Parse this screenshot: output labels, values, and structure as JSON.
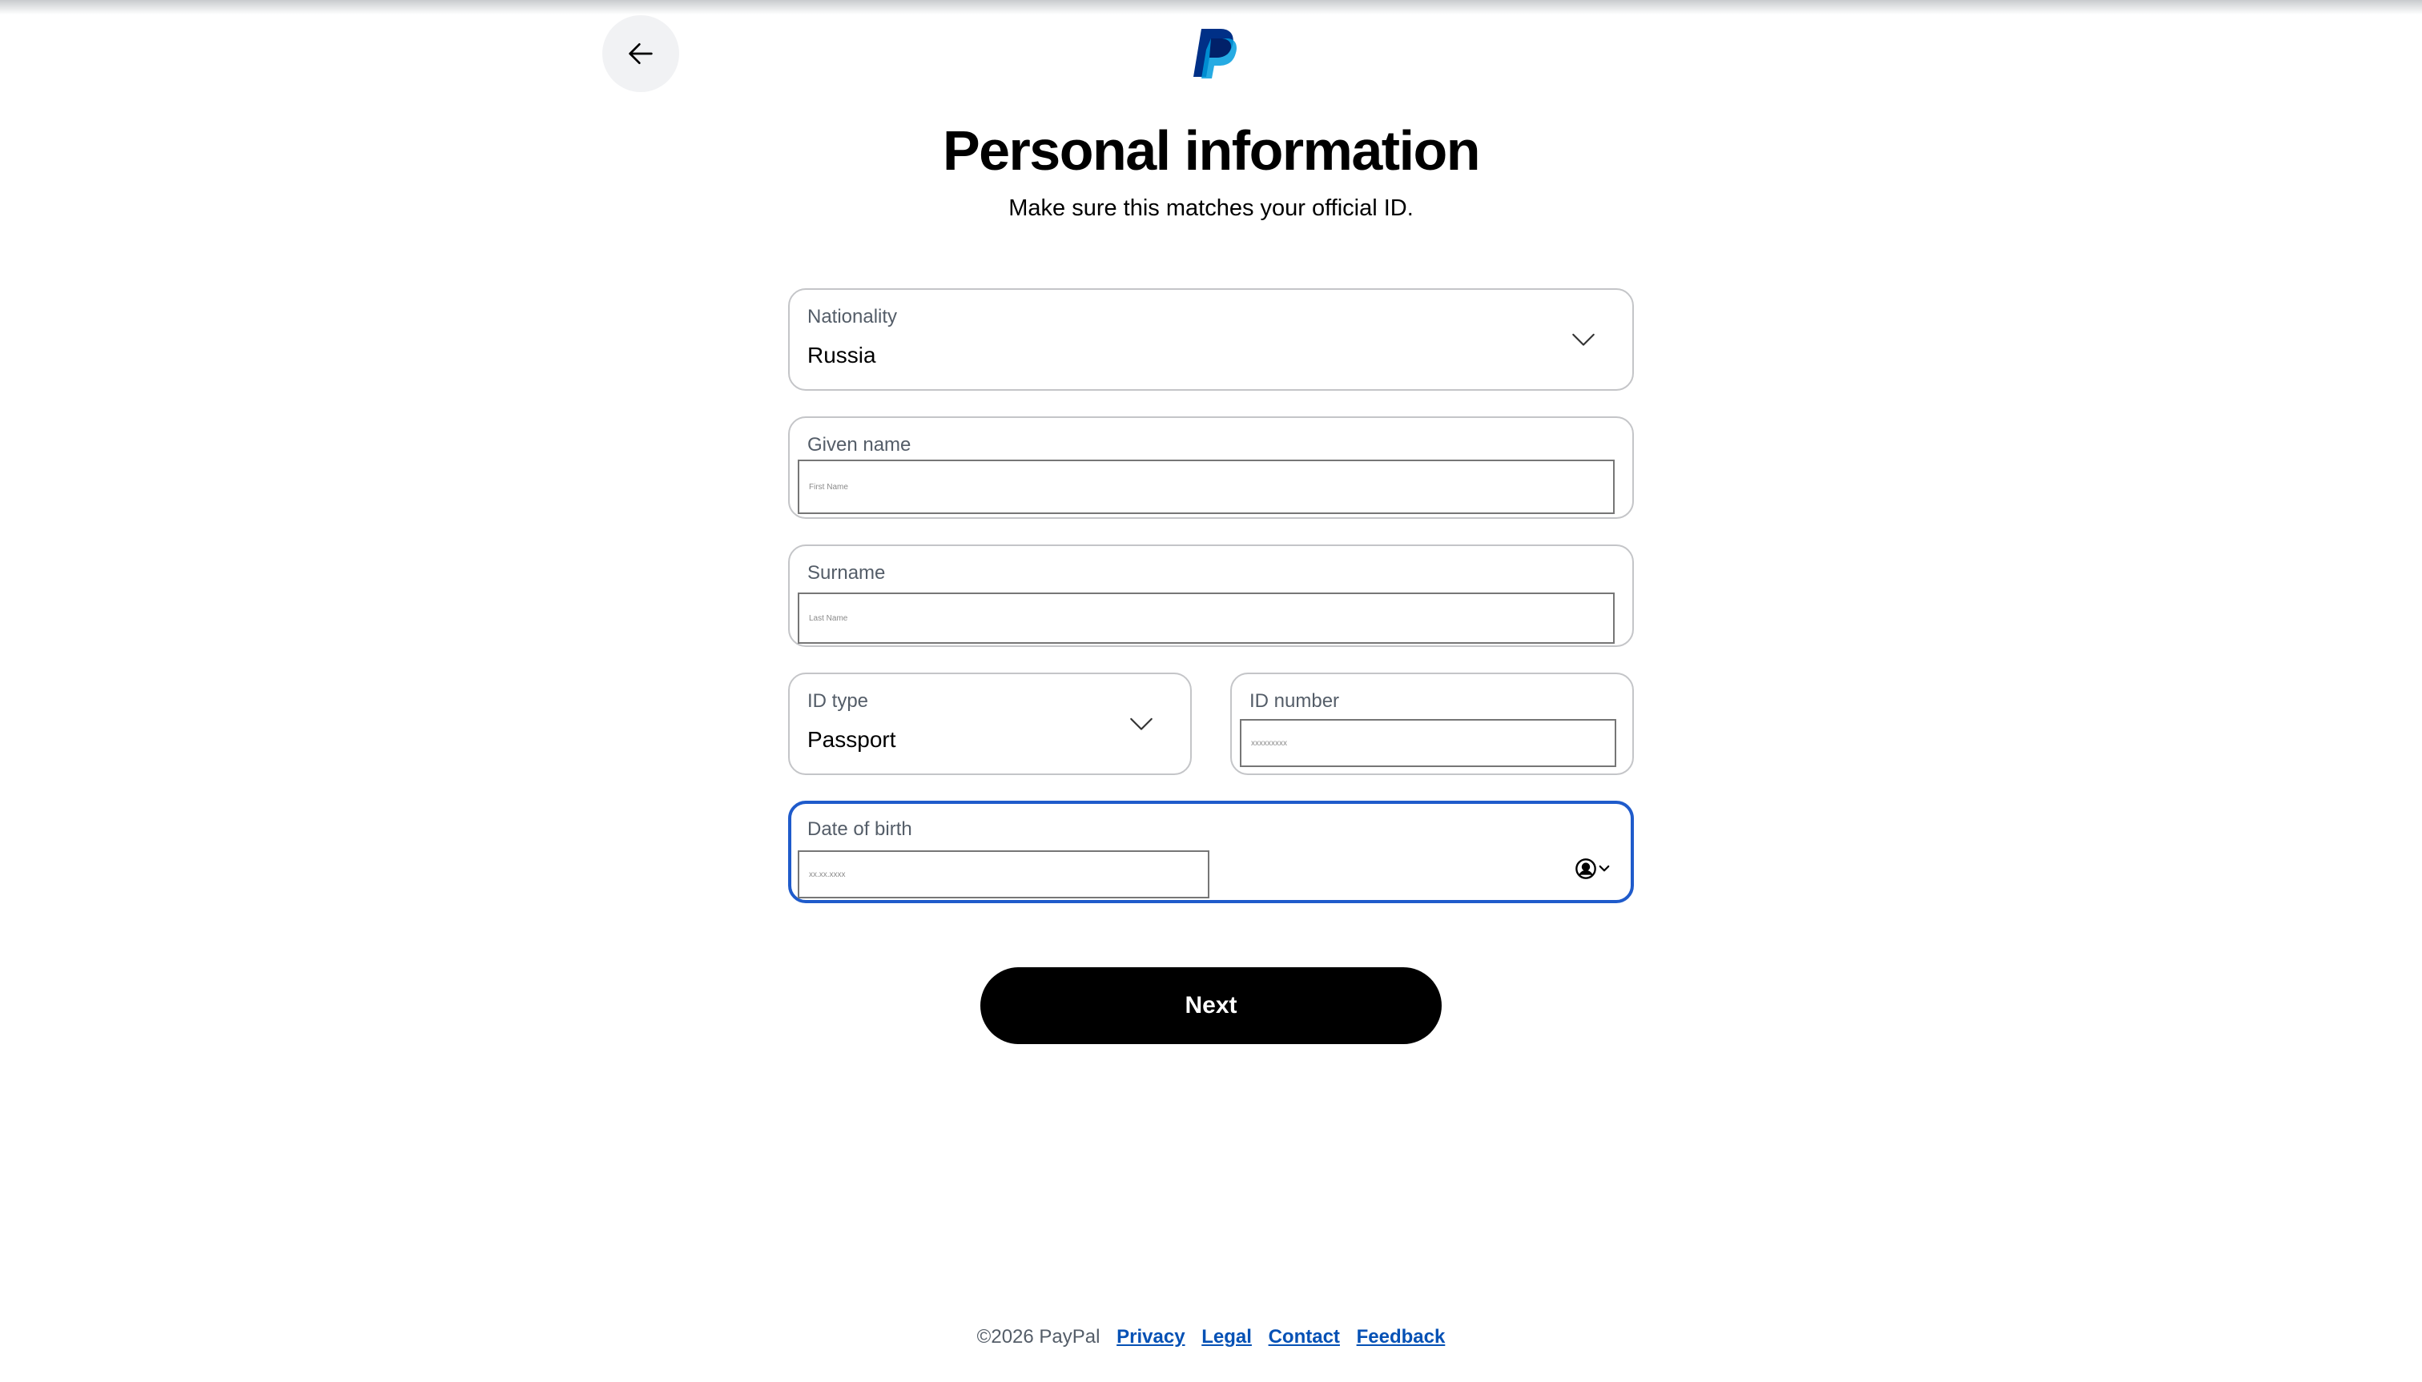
{
  "brand": {
    "name": "PayPal"
  },
  "header": {
    "back_icon": "arrow-left-icon",
    "logo_icon": "paypal-logo"
  },
  "main": {
    "title": "Personal information",
    "subtitle": "Make sure this matches your official ID."
  },
  "form": {
    "nationality": {
      "label": "Nationality",
      "value": "Russia"
    },
    "given_name": {
      "label": "Given name",
      "placeholder": "First Name",
      "value": ""
    },
    "surname": {
      "label": "Surname",
      "placeholder": "Last Name",
      "value": ""
    },
    "id_type": {
      "label": "ID type",
      "value": "Passport"
    },
    "id_number": {
      "label": "ID number",
      "placeholder": "xxxxxxxxx",
      "value": ""
    },
    "date_of_birth": {
      "label": "Date of birth",
      "placeholder": "xx.xx.xxxx",
      "value": "",
      "autofill_icon": "contact-autofill-icon"
    }
  },
  "actions": {
    "next_label": "Next"
  },
  "footer": {
    "copyright": "©2026 PayPal",
    "links": [
      "Privacy",
      "Legal",
      "Contact",
      "Feedback"
    ]
  },
  "colors": {
    "focus_border": "#1f5bcb",
    "link": "#0551b5",
    "button_bg": "#000000",
    "logo_dark": "#003087",
    "logo_light": "#009cde"
  }
}
